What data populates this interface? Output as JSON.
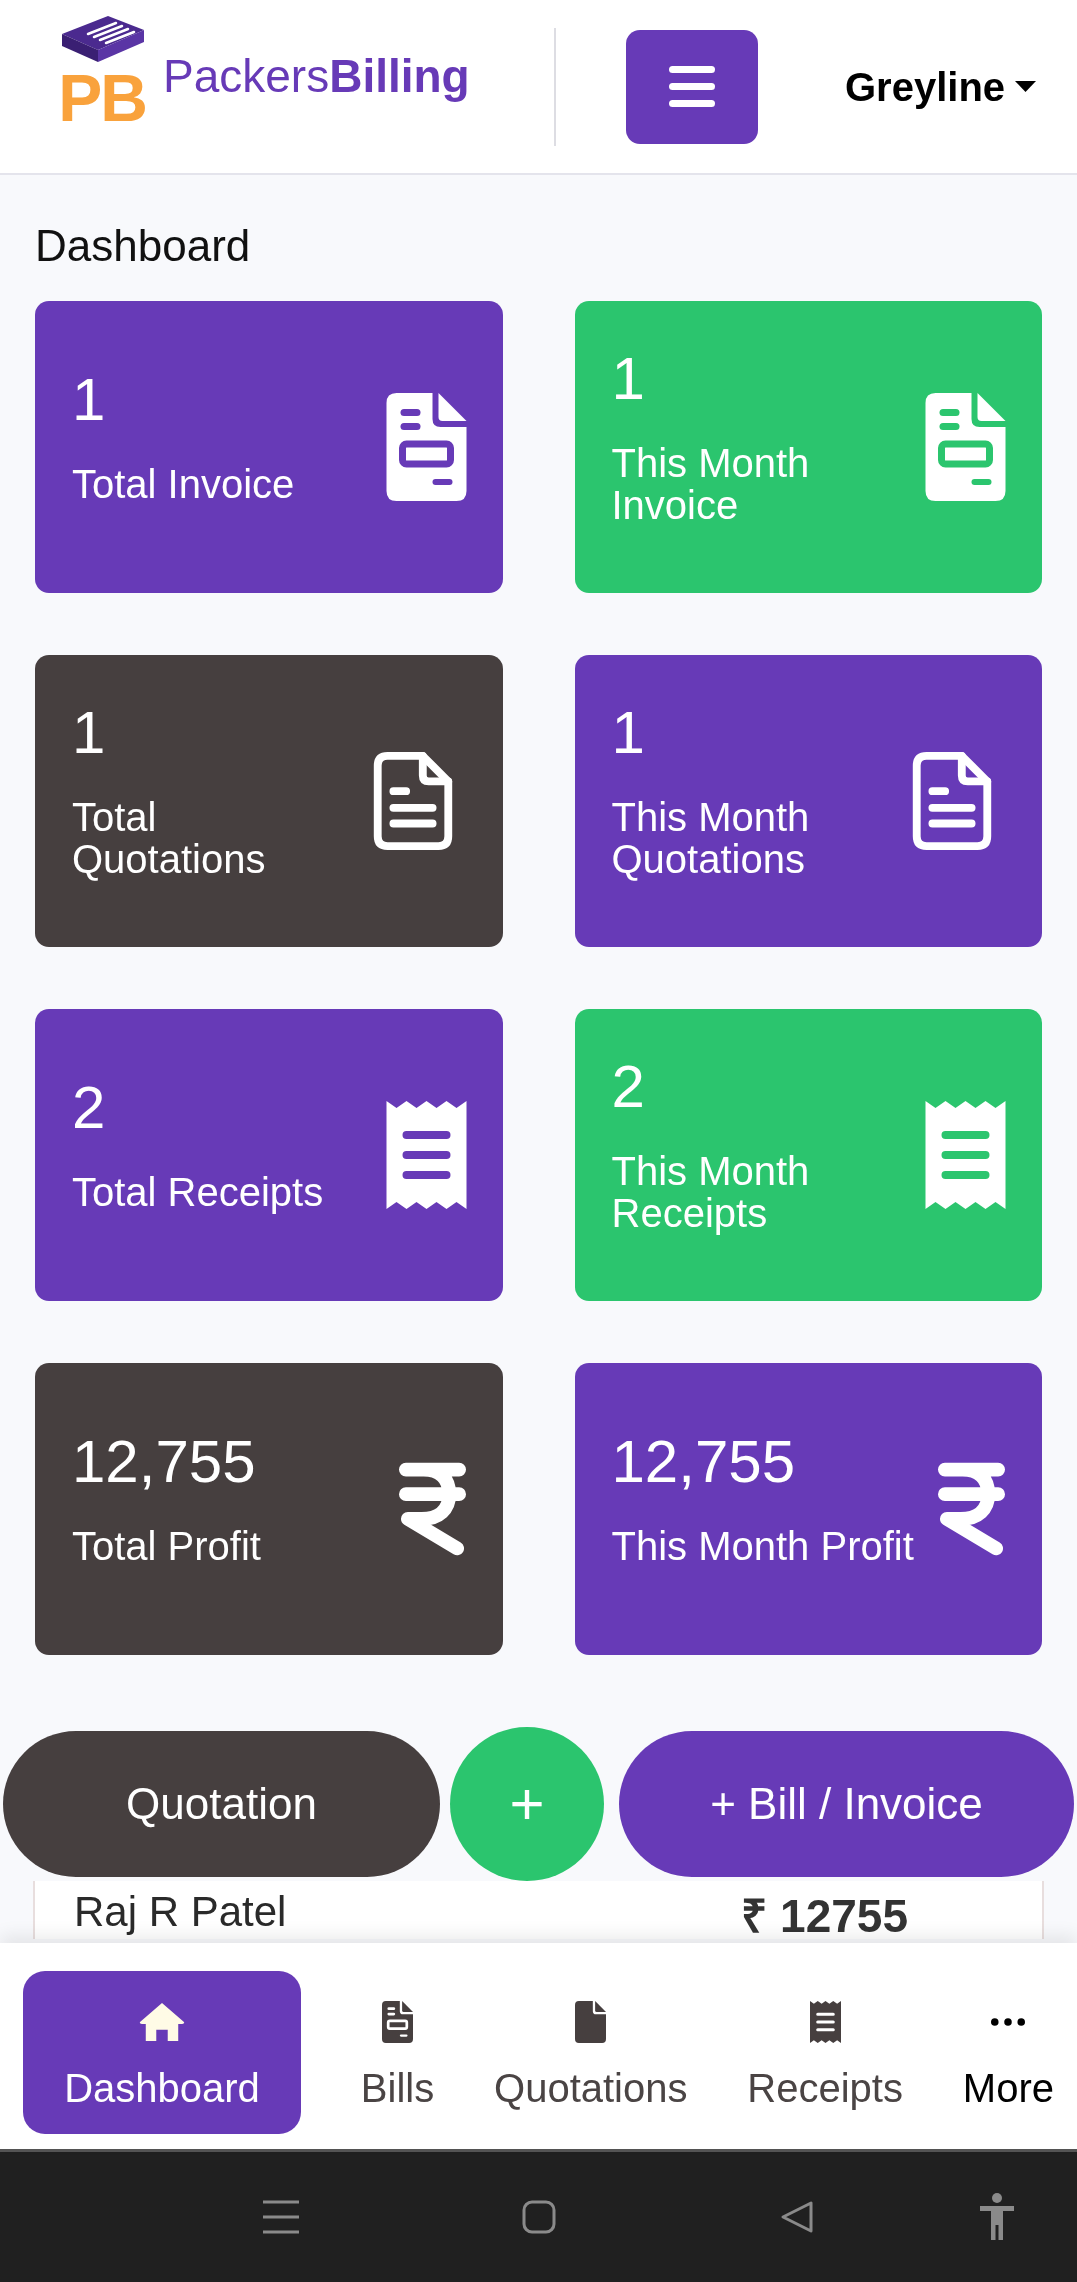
{
  "header": {
    "logo_mark": "PB",
    "brand": "Packers**Billing**",
    "account": "Greyline"
  },
  "title": "Dashboard",
  "stats": [
    {
      "value": "1",
      "label": "Total Invoice",
      "color": "#673ab7",
      "kind": "invoice"
    },
    {
      "value": "1",
      "label": "This Month Invoice",
      "color": "#2bc56e",
      "kind": "invoice"
    },
    {
      "value": "1",
      "label": "Total Quotations",
      "color": "#463f3f",
      "kind": "quotation"
    },
    {
      "value": "1",
      "label": "This Month Quotations",
      "color": "#673ab7",
      "kind": "quotation"
    },
    {
      "value": "2",
      "label": "Total Receipts",
      "color": "#673ab7",
      "kind": "receipt"
    },
    {
      "value": "2",
      "label": "This Month Receipts",
      "color": "#2bc56e",
      "kind": "receipt"
    },
    {
      "value": "12,755",
      "label": "Total Profit",
      "color": "#463f3f",
      "kind": "profit"
    },
    {
      "value": "12,755",
      "label": "This Month Profit",
      "color": "#673ab7",
      "kind": "profit"
    }
  ],
  "actions": {
    "quotation": "Quotation",
    "add": "+",
    "bill": "+ Bill / Invoice"
  },
  "bills": [
    {
      "customer": "Raj R Patel",
      "amount": "₹ 12755"
    }
  ],
  "nav": [
    {
      "label": "Dashboard",
      "kind": "home",
      "selected": true
    },
    {
      "label": "Bills",
      "kind": "bills",
      "selected": false
    },
    {
      "label": "Quotations",
      "kind": "quotations",
      "selected": false
    },
    {
      "label": "Receipts",
      "kind": "receipts",
      "selected": false
    },
    {
      "label": "More",
      "kind": "more",
      "selected": false
    }
  ]
}
